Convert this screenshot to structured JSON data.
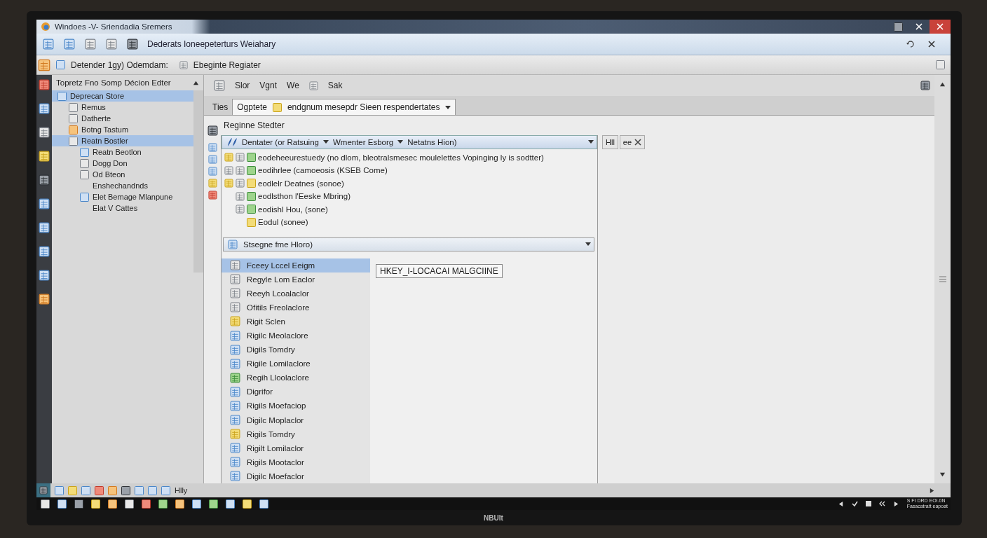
{
  "window": {
    "title": "Windoes -V- Sriendadia Sremers"
  },
  "toolbar": {
    "label": "Dederats Ioneepeterturs Weiahary"
  },
  "address_bar": {
    "label": "Detender  1gy) Odemdam:",
    "path": "Ebeginte Regiater"
  },
  "tree": {
    "header": "Topretz Fno  Somp  Décion Edter",
    "items": [
      {
        "label": "Deprecan Store",
        "selected": true,
        "children": [
          {
            "label": "Remus",
            "selected": false
          },
          {
            "label": "Datherte",
            "selected": false
          },
          {
            "label": "Botng Tastum",
            "selected": false
          },
          {
            "label": "Reatn Bostler",
            "selected": true,
            "children": [
              {
                "label": "Reatn Beotlon",
                "selected": false
              },
              {
                "label": "Dogg Don",
                "selected": false
              },
              {
                "label": "Od Bteon",
                "selected": false
              },
              {
                "label": "Enshechandnds",
                "selected": false
              },
              {
                "label": "Elet Bemage Mlanpune",
                "selected": false
              },
              {
                "label": "Elat V Cattes",
                "selected": false
              }
            ]
          }
        ]
      }
    ]
  },
  "main_toolbar": [
    "Slor",
    "Vgnt",
    "We",
    "Sak"
  ],
  "tabs": [
    {
      "label": "Ties",
      "selected": false
    },
    {
      "label": "Ogptete",
      "selected": true,
      "detail": "endgnum mesepdr Sieen respendertates"
    }
  ],
  "heading": "Reginne Stedter",
  "filter": {
    "label": "Dentater (or Ratsuing",
    "option_1": "Wmenter Esborg",
    "option_2": "Netatns Hion)"
  },
  "side_buttons": [
    "Hll",
    "ee"
  ],
  "entries": [
    "eodeheeurestuedy (no dlom, bleotralsmesec moulelettes Vopinging ly is sodtter)",
    "eodihrlee (camoeosis (KSEB Come)",
    "eodlelr Deatnes (sonoe)",
    "eodlsthon l'Eeske Mbring)",
    "eodishl Hou, (sone)",
    "Eodul (sonee)"
  ],
  "group": {
    "label": "Stsegne fme Hloro)"
  },
  "list": [
    {
      "label": "Fceey Lccel Eeigm",
      "selected": true
    },
    {
      "label": "Regyle Lom Eaclor",
      "selected": false
    },
    {
      "label": "Reeyh Lcoalaclor",
      "selected": false
    },
    {
      "label": "Ofitils Freolaclore",
      "selected": false
    },
    {
      "label": "Rigit Sclen",
      "selected": false
    },
    {
      "label": "Rigilc Meolaclore",
      "selected": false
    },
    {
      "label": "Digils Tomdry",
      "selected": false
    },
    {
      "label": "Rigile Lomilaclore",
      "selected": false
    },
    {
      "label": "Regih Lloolaclore",
      "selected": false
    },
    {
      "label": "Digrifor",
      "selected": false
    },
    {
      "label": "Rigils Moefaciop",
      "selected": false
    },
    {
      "label": "Digilc Moplaclor",
      "selected": false
    },
    {
      "label": "Rigils Tomdry",
      "selected": false
    },
    {
      "label": "Rigilt Lomilaclor",
      "selected": false
    },
    {
      "label": "Rigils Mootaclor",
      "selected": false
    },
    {
      "label": "Digilc Moefaclor",
      "selected": false
    }
  ],
  "key_path": "HKEY_I-LOCACAI MALGCIINE",
  "status_bar": {
    "label": "Hlly"
  },
  "tray": {
    "line_1": "S FI DRD EOI.0N",
    "line_2": "Fasacatratt eapoat"
  },
  "monitor": {
    "brand": "NBUIt"
  }
}
